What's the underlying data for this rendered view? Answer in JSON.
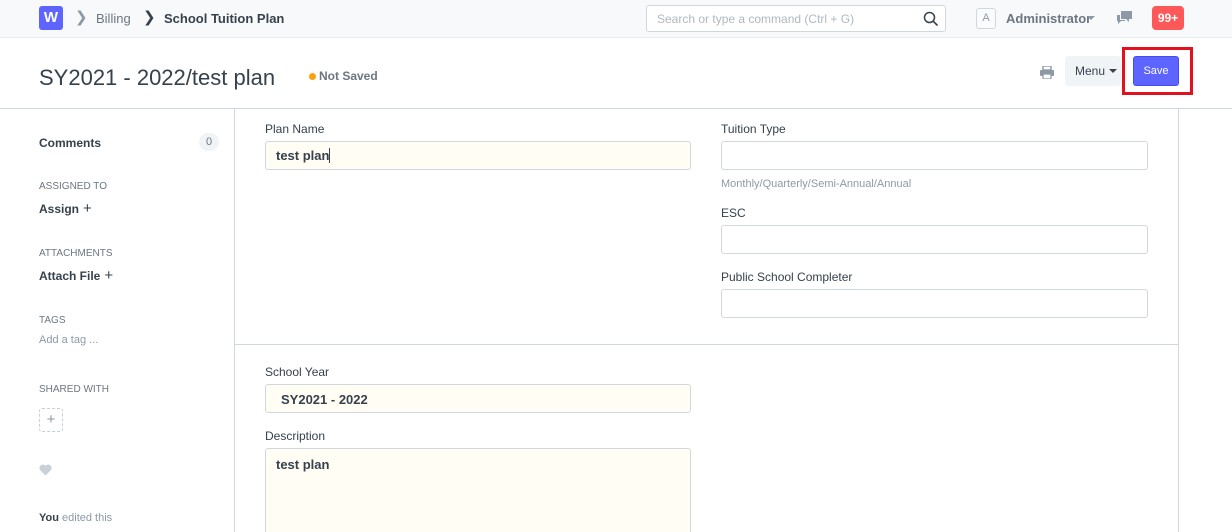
{
  "navbar": {
    "logo_text": "W",
    "breadcrumbs": [
      "Billing",
      "School Tuition Plan"
    ],
    "search_placeholder": "Search or type a command (Ctrl + G)",
    "user_initial": "A",
    "user_name": "Administrator",
    "notification_count": "99+"
  },
  "page": {
    "title": "SY2021 - 2022/test plan",
    "status": "Not Saved",
    "menu_label": "Menu",
    "save_label": "Save"
  },
  "sidebar": {
    "comments_label": "Comments",
    "comments_count": "0",
    "assigned_to_label": "ASSIGNED TO",
    "assign_label": "Assign",
    "attachments_label": "ATTACHMENTS",
    "attach_file_label": "Attach File",
    "tags_label": "TAGS",
    "add_tag_label": "Add a tag ...",
    "shared_with_label": "SHARED WITH",
    "timeline_user": "You",
    "timeline_text": "edited this"
  },
  "form": {
    "plan_name": {
      "label": "Plan Name",
      "value": "test plan"
    },
    "tuition_type": {
      "label": "Tuition Type",
      "value": "",
      "help": "Monthly/Quarterly/Semi-Annual/Annual"
    },
    "esc": {
      "label": "ESC",
      "value": ""
    },
    "public_school_completer": {
      "label": "Public School Completer",
      "value": ""
    },
    "school_year": {
      "label": "School Year",
      "value": "SY2021 - 2022"
    },
    "description": {
      "label": "Description",
      "value": "test plan"
    }
  },
  "colors": {
    "primary": "#5e64ff",
    "notification": "#ff5858",
    "status_dot": "#ffa00a",
    "highlight": "#e3101e"
  }
}
